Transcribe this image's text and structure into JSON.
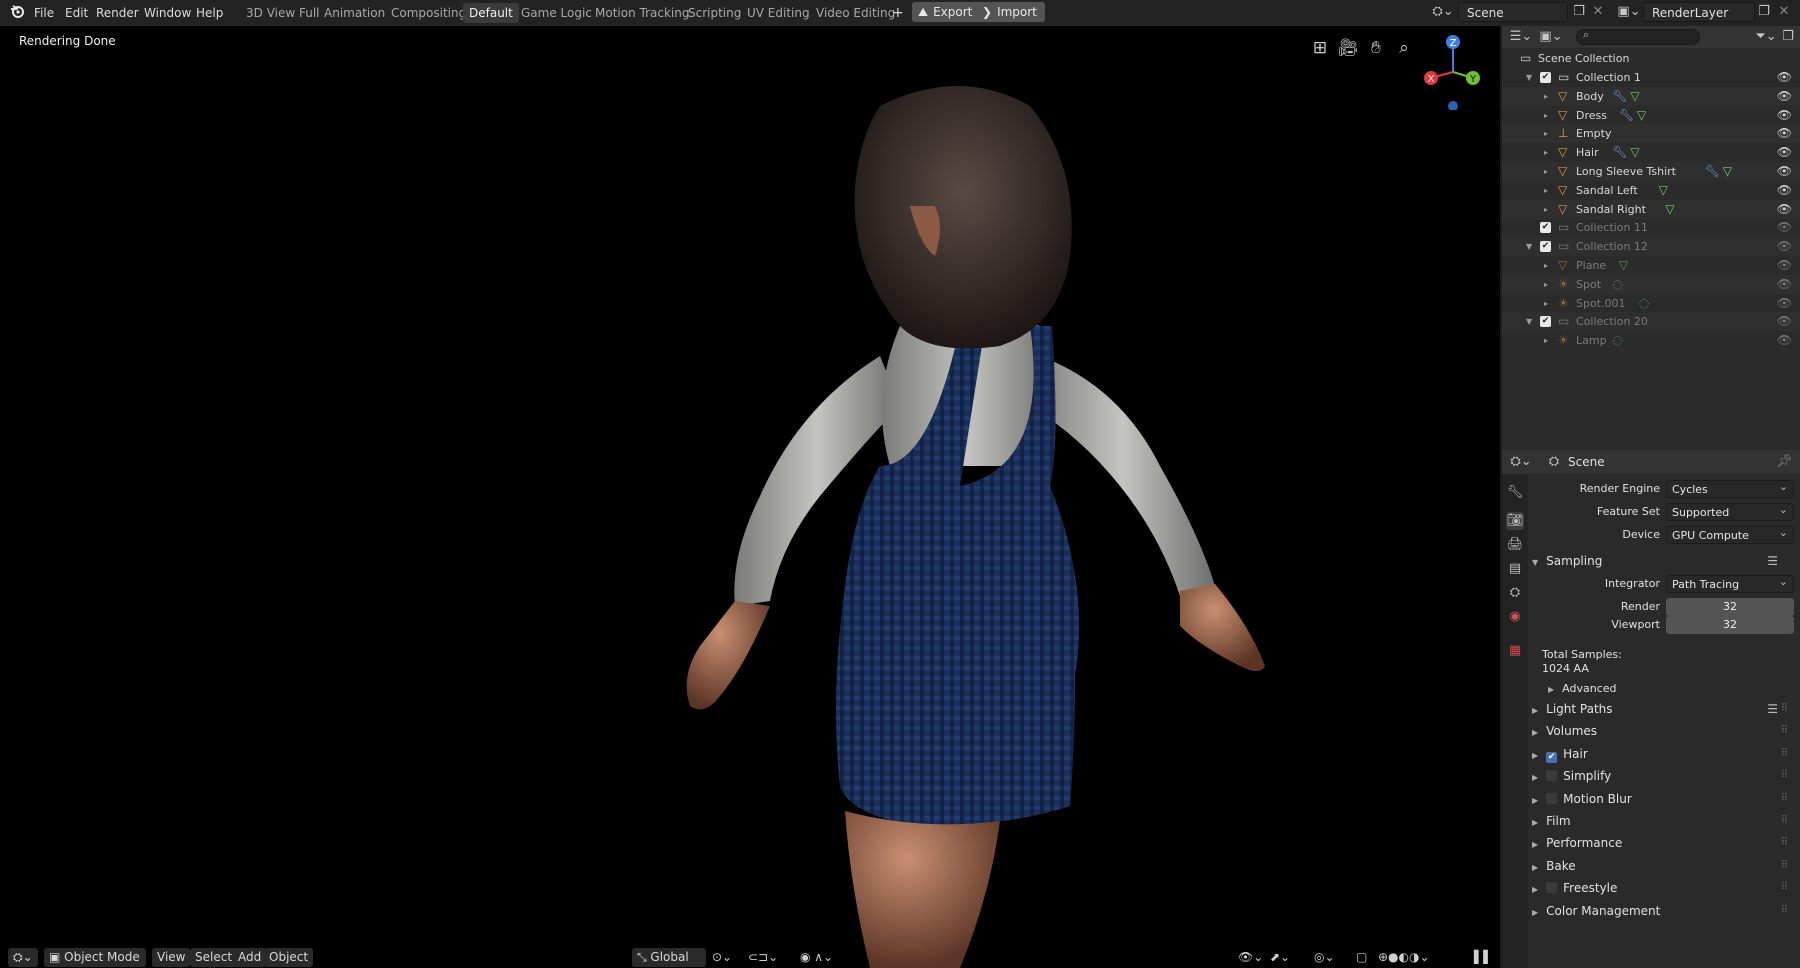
{
  "menus": [
    "File",
    "Edit",
    "Render",
    "Window",
    "Help"
  ],
  "workspaces": [
    "3D View Full",
    "Animation",
    "Compositing",
    "Default",
    "Game Logic",
    "Motion Tracking",
    "Scripting",
    "UV Editing",
    "Video Editing"
  ],
  "active_workspace": "Default",
  "add_workspace": "+",
  "export_label": "Export",
  "import_label": "Import",
  "scene_name": "Scene",
  "render_layer": "RenderLayer",
  "viewport": {
    "status": "Rendering Done",
    "gizmo": {
      "z": "Z",
      "y": "Y",
      "x": "X"
    }
  },
  "viewport_header": {
    "mode": "Object Mode",
    "menus": [
      "View",
      "Select",
      "Add",
      "Object"
    ],
    "orientation": "Global"
  },
  "outliner": {
    "search_placeholder": "",
    "root": "Scene Collection",
    "rows": [
      {
        "label": "Collection 1",
        "type": "collection",
        "depth": 1,
        "dim": false,
        "check": true,
        "tri": "▼"
      },
      {
        "label": "Body",
        "type": "mesh",
        "depth": 2,
        "dim": false,
        "mods": [
          "wrench",
          "mesh"
        ]
      },
      {
        "label": "Dress",
        "type": "mesh",
        "depth": 2,
        "dim": false,
        "mods": [
          "wrench",
          "mesh"
        ]
      },
      {
        "label": "Empty",
        "type": "empty",
        "depth": 2,
        "dim": false,
        "mods": []
      },
      {
        "label": "Hair",
        "type": "mesh",
        "depth": 2,
        "dim": false,
        "mods": [
          "wrench",
          "mesh"
        ]
      },
      {
        "label": "Long Sleeve Tshirt",
        "type": "mesh",
        "depth": 2,
        "dim": false,
        "mods": [
          "wrench",
          "mesh"
        ]
      },
      {
        "label": "Sandal Left",
        "type": "mesh",
        "depth": 2,
        "dim": false,
        "mods": [
          "mesh"
        ]
      },
      {
        "label": "Sandal Right",
        "type": "mesh",
        "depth": 2,
        "dim": false,
        "mods": [
          "mesh"
        ]
      },
      {
        "label": "Collection 11",
        "type": "collection",
        "depth": 1,
        "dim": true,
        "check": true,
        "tri": ""
      },
      {
        "label": "Collection 12",
        "type": "collection",
        "depth": 1,
        "dim": true,
        "check": true,
        "tri": "▼"
      },
      {
        "label": "Plane",
        "type": "mesh",
        "depth": 2,
        "dim": true,
        "mods": [
          "mesh"
        ]
      },
      {
        "label": "Spot",
        "type": "light",
        "depth": 2,
        "dim": true,
        "mods": [
          "light"
        ]
      },
      {
        "label": "Spot.001",
        "type": "light",
        "depth": 2,
        "dim": true,
        "mods": [
          "light"
        ]
      },
      {
        "label": "Collection 20",
        "type": "collection",
        "depth": 1,
        "dim": true,
        "check": true,
        "tri": "▼"
      },
      {
        "label": "Lamp",
        "type": "light",
        "depth": 2,
        "dim": true,
        "mods": [
          "light"
        ]
      }
    ]
  },
  "properties": {
    "context": "Scene",
    "render_engine_label": "Render Engine",
    "render_engine": "Cycles",
    "feature_set_label": "Feature Set",
    "feature_set": "Supported",
    "device_label": "Device",
    "device": "GPU Compute",
    "sampling": "Sampling",
    "integrator_label": "Integrator",
    "integrator": "Path Tracing",
    "render_label": "Render",
    "render_samples": "32",
    "viewport_label": "Viewport",
    "viewport_samples": "32",
    "total_samples_label": "Total Samples:",
    "total_samples": "1024 AA",
    "advanced": "Advanced",
    "sections": [
      {
        "label": "Light Paths",
        "checkbox": null,
        "list": true
      },
      {
        "label": "Volumes",
        "checkbox": null
      },
      {
        "label": "Hair",
        "checkbox": true
      },
      {
        "label": "Simplify",
        "checkbox": false
      },
      {
        "label": "Motion Blur",
        "checkbox": false
      },
      {
        "label": "Film",
        "checkbox": null
      },
      {
        "label": "Performance",
        "checkbox": null
      },
      {
        "label": "Bake",
        "checkbox": null
      },
      {
        "label": "Freestyle",
        "checkbox": false
      },
      {
        "label": "Color Management",
        "checkbox": null
      }
    ]
  },
  "colors": {
    "accent": "#4772b3",
    "mesh_icon": "#e8953a",
    "modifier_icon": "#6a9ee0",
    "data_icon": "#6fce6f",
    "gizmo_x": "#e0393e",
    "gizmo_y": "#6ec030",
    "gizmo_z": "#3f7fe6"
  }
}
